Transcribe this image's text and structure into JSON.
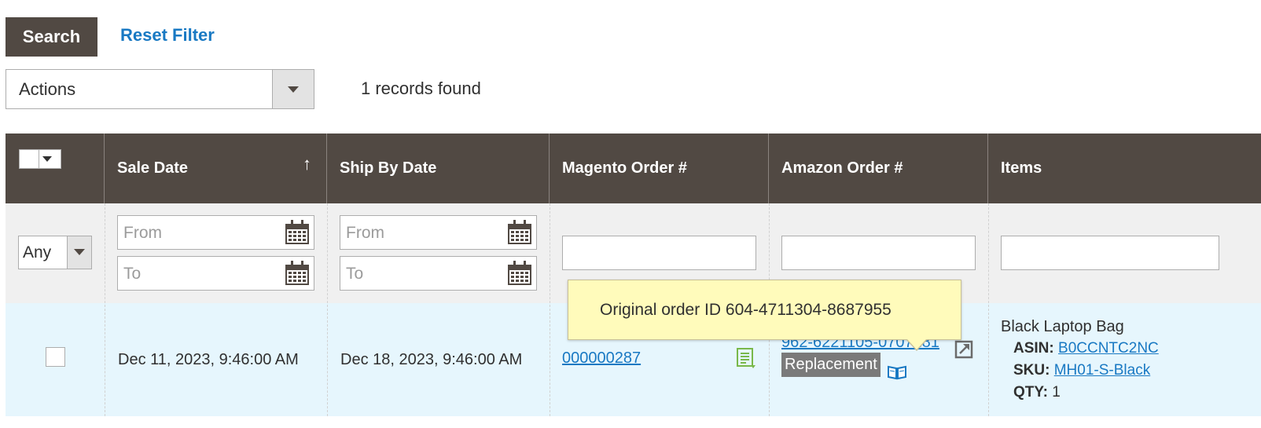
{
  "toolbar": {
    "search_label": "Search",
    "reset_label": "Reset Filter",
    "actions_label": "Actions",
    "records_text": "1 records found"
  },
  "grid": {
    "columns": [
      "Sale Date",
      "Ship By Date",
      "Magento Order #",
      "Amazon Order #",
      "Items"
    ],
    "sort_indicator": "↑",
    "filters": {
      "any_label": "Any",
      "sale_from": "From",
      "sale_to": "To",
      "ship_from": "From",
      "ship_to": "To"
    },
    "row": {
      "sale_date": "Dec 11, 2023, 9:46:00 AM",
      "ship_by_date": "Dec 18, 2023, 9:46:00 AM",
      "magento_order": "000000287",
      "amazon_order": "962-6221105-0707181",
      "replacement_label": "Replacement",
      "item_name": "Black Laptop Bag",
      "asin_label": "ASIN:",
      "asin_value": "B0CCNTC2NC",
      "sku_label": "SKU:",
      "sku_value": "MH01-S-Black",
      "qty_label": "QTY:",
      "qty_value": "1"
    }
  },
  "tooltip": {
    "text": "Original order ID 604-4711304-8687955"
  },
  "colors": {
    "header_bg": "#514943",
    "link": "#1979c3",
    "row_highlight": "#e6f6fd",
    "tooltip_bg": "#fffbbb"
  }
}
